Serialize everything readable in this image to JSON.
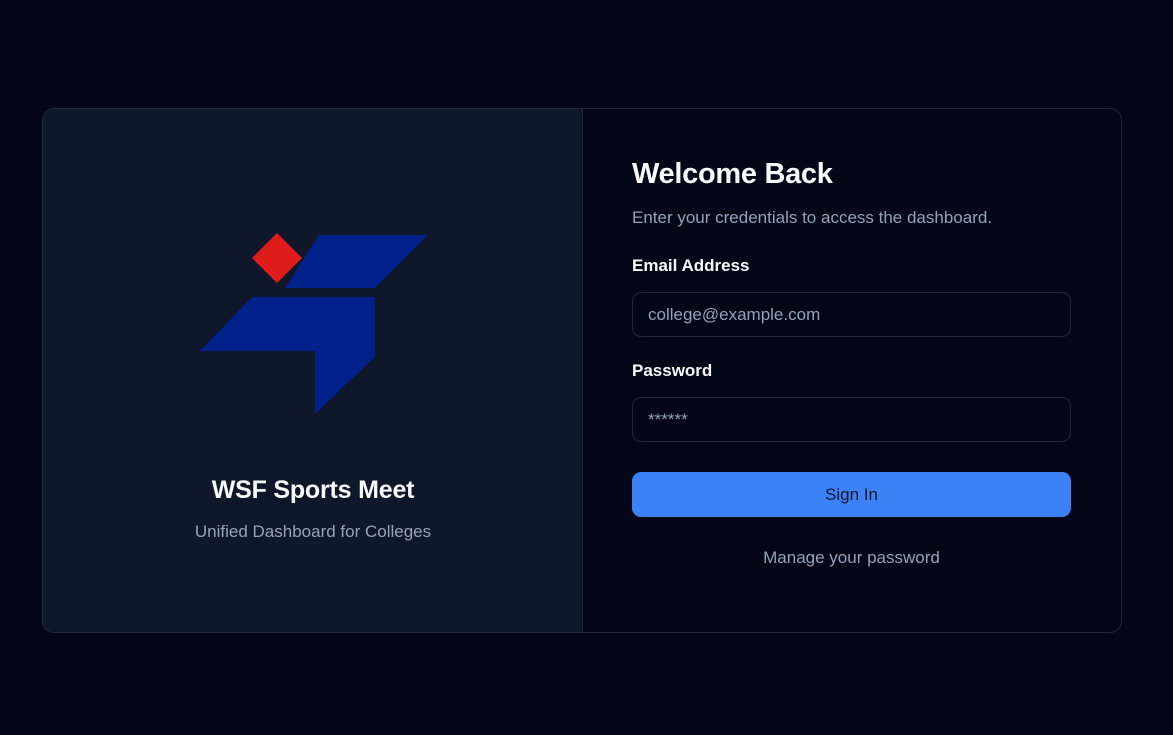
{
  "brand": {
    "title": "WSF Sports Meet",
    "subtitle": "Unified Dashboard for Colleges",
    "logo_icon": "wsf-logo-icon"
  },
  "form": {
    "heading": "Welcome Back",
    "subheading": "Enter your credentials to access the dashboard.",
    "email_label": "Email Address",
    "email_placeholder": "college@example.com",
    "email_value": "",
    "password_label": "Password",
    "password_placeholder": "******",
    "password_value": "",
    "signin_label": "Sign In",
    "manage_password_label": "Manage your password"
  },
  "colors": {
    "page_background": "#020617",
    "brand_panel_background": "#0f172a",
    "accent": "#3b82f6",
    "logo_blue": "#00218a",
    "logo_red": "#e01b1b",
    "muted_text": "#94a3b8",
    "border": "#1e293b"
  }
}
